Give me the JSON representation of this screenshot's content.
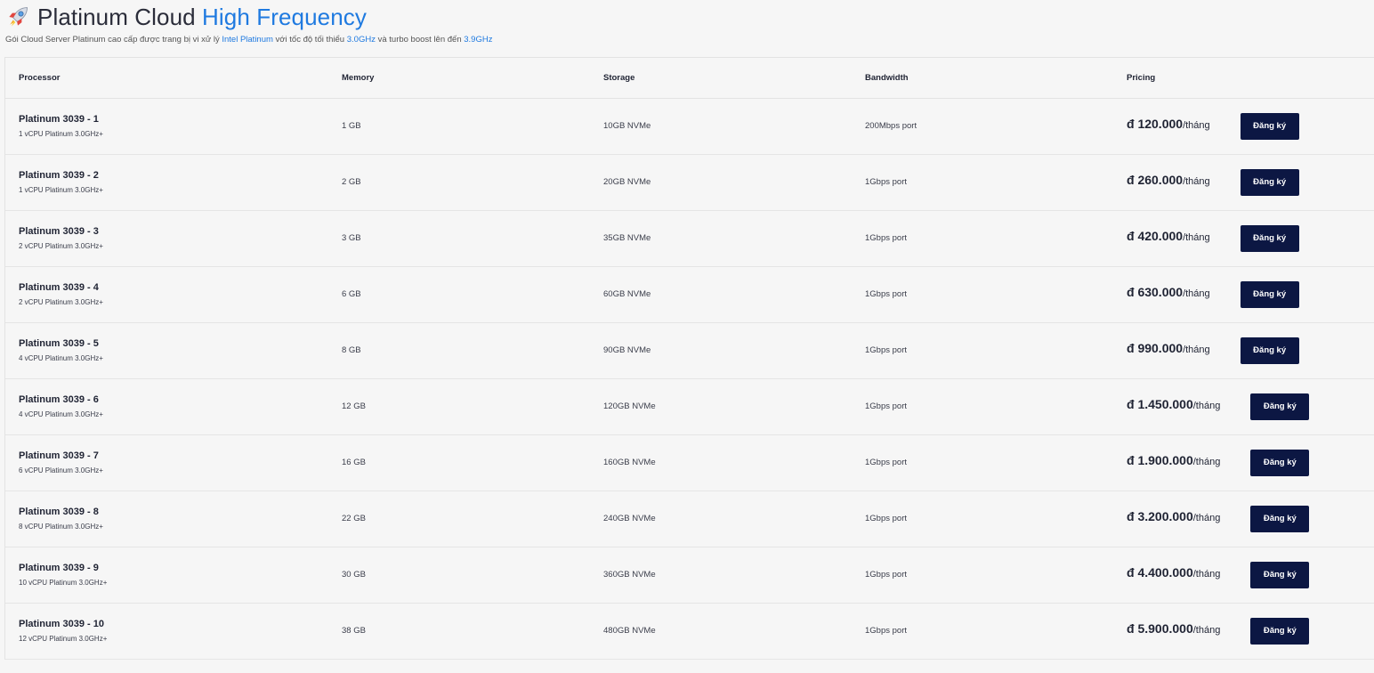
{
  "header": {
    "icon": "rocket-icon",
    "title_main": "Platinum Cloud",
    "title_accent": "High Frequency",
    "subtitle_parts": {
      "p1": "Gói Cloud Server Platinum cao cấp được trang bị vi xử lý ",
      "h1": "Intel Platinum",
      "p2": " với tốc độ tối thiểu ",
      "h2": "3.0GHz",
      "p3": " và turbo boost lên đến ",
      "h3": "3.9GHz"
    }
  },
  "table": {
    "columns": [
      "Processor",
      "Memory",
      "Storage",
      "Bandwidth",
      "Pricing"
    ],
    "currency": "đ",
    "unit": "/tháng",
    "button_label": "Đăng ký",
    "rows": [
      {
        "name": "Platinum 3039 - 1",
        "sub": "1 vCPU Platinum 3.0GHz+",
        "memory": "1 GB",
        "storage": "10GB NVMe",
        "bandwidth": "200Mbps port",
        "price": "120.000"
      },
      {
        "name": "Platinum 3039 - 2",
        "sub": "1 vCPU Platinum 3.0GHz+",
        "memory": "2 GB",
        "storage": "20GB NVMe",
        "bandwidth": "1Gbps port",
        "price": "260.000"
      },
      {
        "name": "Platinum 3039 - 3",
        "sub": "2 vCPU Platinum 3.0GHz+",
        "memory": "3 GB",
        "storage": "35GB NVMe",
        "bandwidth": "1Gbps port",
        "price": "420.000"
      },
      {
        "name": "Platinum 3039 - 4",
        "sub": "2 vCPU Platinum 3.0GHz+",
        "memory": "6 GB",
        "storage": "60GB NVMe",
        "bandwidth": "1Gbps port",
        "price": "630.000"
      },
      {
        "name": "Platinum 3039 - 5",
        "sub": "4 vCPU Platinum 3.0GHz+",
        "memory": "8 GB",
        "storage": "90GB NVMe",
        "bandwidth": "1Gbps port",
        "price": "990.000"
      },
      {
        "name": "Platinum 3039 - 6",
        "sub": "4 vCPU Platinum 3.0GHz+",
        "memory": "12 GB",
        "storage": "120GB NVMe",
        "bandwidth": "1Gbps port",
        "price": "1.450.000"
      },
      {
        "name": "Platinum 3039 - 7",
        "sub": "6 vCPU Platinum 3.0GHz+",
        "memory": "16 GB",
        "storage": "160GB NVMe",
        "bandwidth": "1Gbps port",
        "price": "1.900.000"
      },
      {
        "name": "Platinum 3039 - 8",
        "sub": "8 vCPU Platinum 3.0GHz+",
        "memory": "22 GB",
        "storage": "240GB NVMe",
        "bandwidth": "1Gbps port",
        "price": "3.200.000"
      },
      {
        "name": "Platinum 3039 - 9",
        "sub": "10 vCPU Platinum 3.0GHz+",
        "memory": "30 GB",
        "storage": "360GB NVMe",
        "bandwidth": "1Gbps port",
        "price": "4.400.000"
      },
      {
        "name": "Platinum 3039 - 10",
        "sub": "12 vCPU Platinum 3.0GHz+",
        "memory": "38 GB",
        "storage": "480GB NVMe",
        "bandwidth": "1Gbps port",
        "price": "5.900.000"
      }
    ]
  },
  "colors": {
    "accent": "#1f7ae0",
    "button_bg": "#0c1743",
    "background": "#f6f6f6"
  }
}
